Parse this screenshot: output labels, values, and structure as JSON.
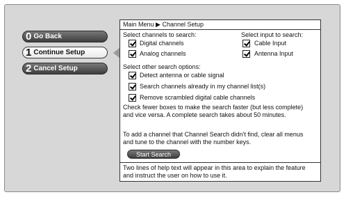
{
  "menu": {
    "go_back": {
      "num": "0",
      "label": "Go Back"
    },
    "continue_setup": {
      "num": "1",
      "label": "Continue Setup"
    },
    "cancel_setup": {
      "num": "2",
      "label": "Cancel Setup"
    }
  },
  "panel": {
    "breadcrumb": "Main Menu ▶ Channel Setup",
    "channels_heading": "Select channels to search:",
    "digital_channels": "Digital channels",
    "analog_channels": "Analog channels",
    "input_heading": "Select input to search:",
    "cable_input": "Cable Input",
    "antenna_input": "Antenna Input",
    "other_heading": "Select other search options:",
    "detect_signal": "Detect antenna or cable signal",
    "search_existing": "Search channels already in my channel list(s)",
    "remove_scrambled": "Remove scrambled digital cable channels",
    "info_text": "Check fewer boxes to make the search faster (but less complete) and vice versa. A complete search takes about 50 minutes.",
    "add_channel_text": "To add a channel that Channel Search didn't find, clear all menus and tune to the channel with the number keys.",
    "start_search": "Start Search",
    "help_text": "Two lines of help text will appear in this area to explain the feature and instruct the user on how to use it."
  }
}
